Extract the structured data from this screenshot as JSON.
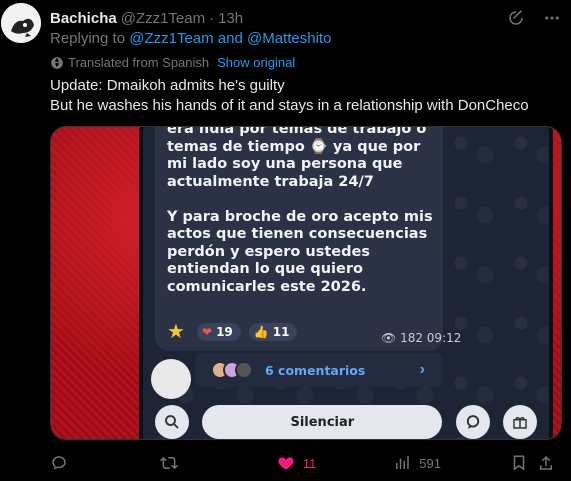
{
  "tweet": {
    "author_name": "Bachicha",
    "author_handle": "@Zzz1Team",
    "separator": "·",
    "time": "13h",
    "reply_prefix": "Replying to ",
    "reply_targets": "@Zzz1Team and @Matteshito",
    "translated_from": "Translated from Spanish",
    "show_original": "Show original",
    "text_line1": "Update: Dmaikoh admits he's guilty",
    "text_line2": "But he washes his hands of it and stays in a relationship with DonCheco"
  },
  "media": {
    "message": "era nula por temas de trabajo o\ntemas de tiempo ⌚ ya que por\nmi lado soy una persona que\nactualmente trabaja 24/7\n\nY para broche de oro acepto mis\nactos que tienen consecuencias\nperdón y espero ustedes\nentiendan lo que quiero\ncomunicarles este 2026.",
    "reactions": [
      {
        "emoji": "❤",
        "count": "19"
      },
      {
        "emoji": "👍",
        "count": "11"
      }
    ],
    "views": "182",
    "msg_time": "09:12",
    "comments_label": "6 comentarios",
    "silence_label": "Silenciar"
  },
  "actions": {
    "replies": "",
    "retweets": "",
    "likes": "11",
    "views": "591"
  },
  "colors": {
    "accent": "#1d9bf0",
    "like": "#f91880",
    "muted": "#71767b"
  }
}
